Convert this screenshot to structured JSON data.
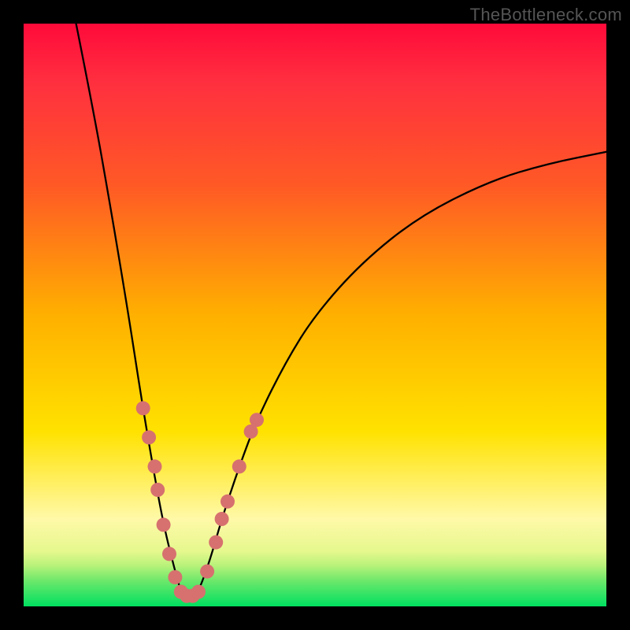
{
  "watermark": "TheBottleneck.com",
  "chart_data": {
    "type": "line",
    "title": "",
    "xlabel": "",
    "ylabel": "",
    "xlim": [
      0,
      100
    ],
    "ylim": [
      0,
      100
    ],
    "grid": false,
    "legend": false,
    "gradient_bands": [
      {
        "y_from": 100,
        "y_to": 72,
        "color_top": "#ff0a3a",
        "color_bottom": "#ff5a25"
      },
      {
        "y_from": 72,
        "y_to": 45,
        "color_top": "#ff5a25",
        "color_bottom": "#ffb800"
      },
      {
        "y_from": 45,
        "y_to": 22,
        "color_top": "#ffb800",
        "color_bottom": "#ffe400"
      },
      {
        "y_from": 22,
        "y_to": 10,
        "color_top": "#ffe400",
        "color_bottom": "#fff9a8"
      },
      {
        "y_from": 10,
        "y_to": 5,
        "color_top": "#fff9a8",
        "color_bottom": "#b8f27a"
      },
      {
        "y_from": 5,
        "y_to": 0,
        "color_top": "#b8f27a",
        "color_bottom": "#00e060"
      }
    ],
    "curve": {
      "type": "v_shape",
      "notch_x": 28,
      "left_start": {
        "x": 9,
        "y": 100
      },
      "right_end": {
        "x": 100,
        "y": 78
      },
      "points": [
        {
          "x": 9,
          "y": 100
        },
        {
          "x": 12,
          "y": 85
        },
        {
          "x": 15,
          "y": 68
        },
        {
          "x": 18,
          "y": 50
        },
        {
          "x": 20,
          "y": 37
        },
        {
          "x": 22,
          "y": 25
        },
        {
          "x": 24,
          "y": 14
        },
        {
          "x": 26,
          "y": 6
        },
        {
          "x": 27,
          "y": 2.5
        },
        {
          "x": 28,
          "y": 1.5
        },
        {
          "x": 29,
          "y": 1.5
        },
        {
          "x": 30,
          "y": 2.5
        },
        {
          "x": 32,
          "y": 8
        },
        {
          "x": 34,
          "y": 15
        },
        {
          "x": 37,
          "y": 24
        },
        {
          "x": 40,
          "y": 32
        },
        {
          "x": 45,
          "y": 42
        },
        {
          "x": 50,
          "y": 50
        },
        {
          "x": 58,
          "y": 59
        },
        {
          "x": 68,
          "y": 67
        },
        {
          "x": 80,
          "y": 73
        },
        {
          "x": 90,
          "y": 76
        },
        {
          "x": 100,
          "y": 78
        }
      ]
    },
    "markers": {
      "color": "#d6716f",
      "radius_px": 9,
      "points": [
        {
          "x": 20.5,
          "y": 34
        },
        {
          "x": 21.5,
          "y": 29
        },
        {
          "x": 22.5,
          "y": 24
        },
        {
          "x": 23.0,
          "y": 20
        },
        {
          "x": 24.0,
          "y": 14
        },
        {
          "x": 25.0,
          "y": 9
        },
        {
          "x": 26.0,
          "y": 5
        },
        {
          "x": 27.0,
          "y": 2.5
        },
        {
          "x": 28.0,
          "y": 1.8
        },
        {
          "x": 29.0,
          "y": 1.8
        },
        {
          "x": 30.0,
          "y": 2.5
        },
        {
          "x": 31.5,
          "y": 6
        },
        {
          "x": 33.0,
          "y": 11
        },
        {
          "x": 34.0,
          "y": 15
        },
        {
          "x": 35.0,
          "y": 18
        },
        {
          "x": 37.0,
          "y": 24
        },
        {
          "x": 39.0,
          "y": 30
        },
        {
          "x": 40.0,
          "y": 32
        }
      ]
    }
  }
}
